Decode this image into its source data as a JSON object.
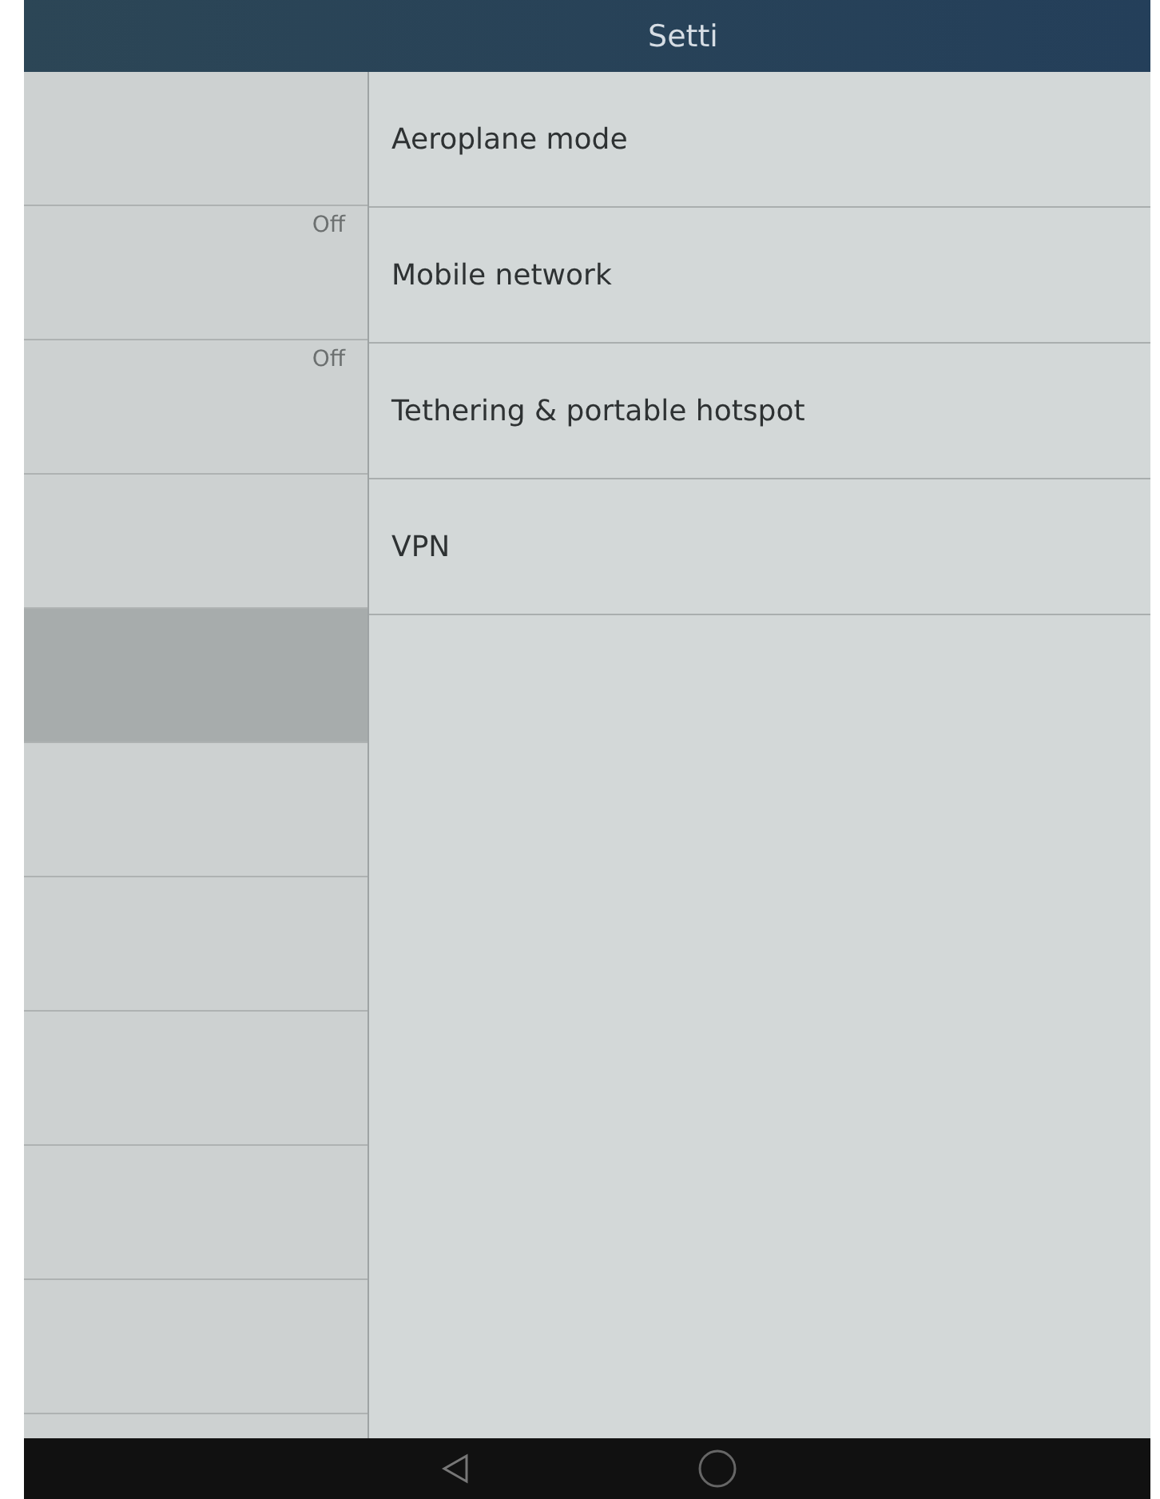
{
  "title_bar": {
    "title": "Setti"
  },
  "left_pane": {
    "items": [
      {
        "value": "",
        "selected": false
      },
      {
        "value": "Off",
        "selected": false
      },
      {
        "value": "Off",
        "selected": false
      },
      {
        "value": "",
        "selected": false
      },
      {
        "value": "",
        "selected": true
      },
      {
        "value": "",
        "selected": false
      },
      {
        "value": "",
        "selected": false
      },
      {
        "value": "",
        "selected": false
      },
      {
        "value": "",
        "selected": false
      },
      {
        "value": "",
        "selected": false
      }
    ]
  },
  "settings_list": {
    "items": [
      {
        "label": "Aeroplane mode"
      },
      {
        "label": "Mobile network"
      },
      {
        "label": "Tethering & portable hotspot"
      },
      {
        "label": "VPN"
      }
    ]
  },
  "nav_bar": {
    "buttons": [
      {
        "kind": "back"
      },
      {
        "kind": "home"
      }
    ]
  }
}
